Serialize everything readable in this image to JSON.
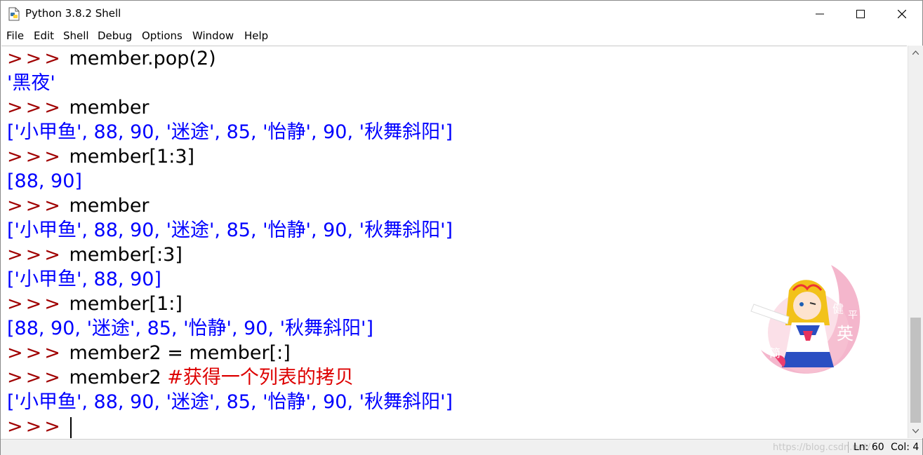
{
  "window": {
    "title": "Python 3.8.2 Shell"
  },
  "menu": [
    {
      "label": "File"
    },
    {
      "label": "Edit"
    },
    {
      "label": "Shell"
    },
    {
      "label": "Debug"
    },
    {
      "label": "Options"
    },
    {
      "label": "Window"
    },
    {
      "label": "Help"
    }
  ],
  "shell": {
    "prompt": ">>>",
    "lines": [
      {
        "kind": "input",
        "text": "member.pop(2)"
      },
      {
        "kind": "output",
        "text": "'黑夜'"
      },
      {
        "kind": "input",
        "text": "member"
      },
      {
        "kind": "output",
        "text": "['小甲鱼', 88, 90, '迷途', 85, '怡静', 90, '秋舞斜阳']"
      },
      {
        "kind": "input",
        "text": "member[1:3]"
      },
      {
        "kind": "output",
        "text": "[88, 90]"
      },
      {
        "kind": "input",
        "text": "member"
      },
      {
        "kind": "output",
        "text": "['小甲鱼', 88, 90, '迷途', 85, '怡静', 90, '秋舞斜阳']"
      },
      {
        "kind": "input",
        "text": "member[:3]"
      },
      {
        "kind": "output",
        "text": "['小甲鱼', 88, 90]"
      },
      {
        "kind": "input",
        "text": "member[1:]"
      },
      {
        "kind": "output",
        "text": "[88, 90, '迷途', 85, '怡静', 90, '秋舞斜阳']"
      },
      {
        "kind": "input",
        "text": "member2 = member[:]"
      },
      {
        "kind": "input",
        "text": "member2 ",
        "comment": "#获得一个列表的拷贝"
      },
      {
        "kind": "output",
        "text": "['小甲鱼', 88, 90, '迷途', 85, '怡静', 90, '秋舞斜阳']"
      },
      {
        "kind": "input",
        "text": ""
      }
    ]
  },
  "sticker": {
    "chars": [
      "健",
      "平",
      "英",
      "简"
    ]
  },
  "status": {
    "watermark": "https://blog.csdn.net/...",
    "line": "Ln: 60",
    "col": "Col: 4"
  },
  "colors": {
    "prompt": "#a00000",
    "output": "#0000ff",
    "comment": "#dd0000",
    "input": "#000000"
  }
}
